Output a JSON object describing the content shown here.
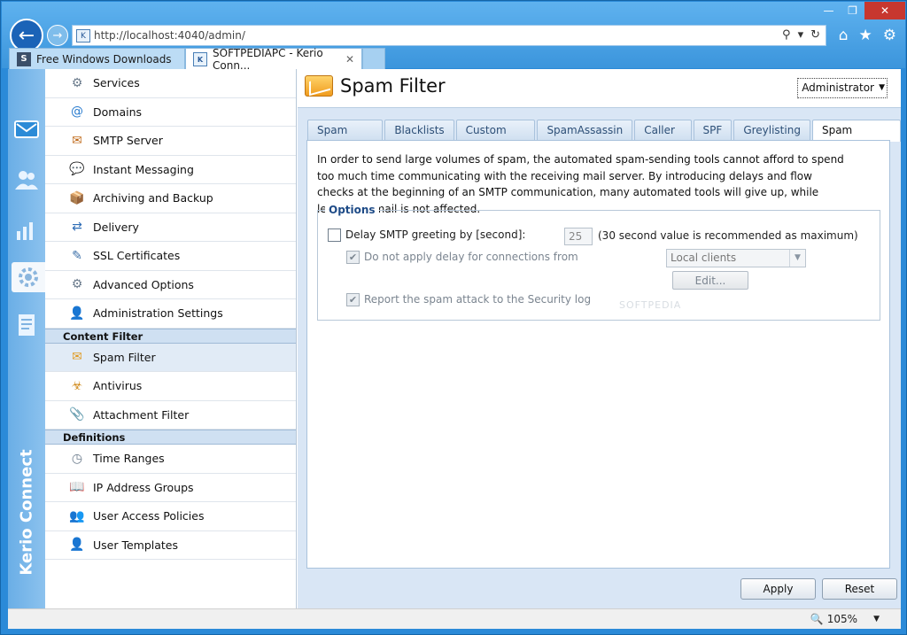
{
  "browser": {
    "window_controls": [
      "—",
      "❐",
      "✕"
    ],
    "url": "http://localhost:4040/admin/",
    "tabs": [
      {
        "label": "Free Windows Downloads",
        "favicon": "S"
      },
      {
        "label": "SOFTPEDIAPC - Kerio Conn...",
        "close": "✕"
      }
    ],
    "zoom": "105%"
  },
  "rail": {
    "brand": "Kerio Connect",
    "icons": [
      "mail-icon",
      "users-icon",
      "statistics-icon",
      "settings-icon",
      "logs-icon"
    ]
  },
  "nav": {
    "items_top": [
      {
        "label": "Services",
        "icon": "services-icon"
      },
      {
        "label": "Domains",
        "icon": "at-icon"
      },
      {
        "label": "SMTP Server",
        "icon": "smtp-icon"
      },
      {
        "label": "Instant Messaging",
        "icon": "chat-icon"
      },
      {
        "label": "Archiving and Backup",
        "icon": "archive-icon"
      },
      {
        "label": "Delivery",
        "icon": "delivery-icon"
      },
      {
        "label": "SSL Certificates",
        "icon": "certificate-icon"
      },
      {
        "label": "Advanced Options",
        "icon": "gears-icon"
      },
      {
        "label": "Administration Settings",
        "icon": "admin-icon"
      }
    ],
    "content_filter_header": "Content Filter",
    "items_content_filter": [
      {
        "label": "Spam Filter",
        "icon": "spam-icon"
      },
      {
        "label": "Antivirus",
        "icon": "antivirus-icon"
      },
      {
        "label": "Attachment Filter",
        "icon": "attachment-icon"
      }
    ],
    "definitions_header": "Definitions",
    "items_definitions": [
      {
        "label": "Time Ranges",
        "icon": "time-icon"
      },
      {
        "label": "IP Address Groups",
        "icon": "ip-book-icon"
      },
      {
        "label": "User Access Policies",
        "icon": "policy-icon"
      },
      {
        "label": "User Templates",
        "icon": "template-icon"
      }
    ]
  },
  "content": {
    "title": "Spam Filter",
    "user_menu": "Administrator",
    "tabs": [
      "Spam Rating",
      "Blacklists",
      "Custom Rules",
      "SpamAssassin",
      "Caller ID",
      "SPF",
      "Greylisting",
      "Spam Repellent"
    ],
    "active_tab": "Spam Repellent",
    "intro": "In order to send large volumes of spam, the automated spam-sending tools cannot afford to spend too much time communicating with the receiving mail server. By introducing delays and flow checks at the beginning of an SMTP communication, many automated tools will give up, while legitimate mail is not affected.",
    "options": {
      "legend": "Options",
      "delay_label": "Delay SMTP greeting by [second]:",
      "delay_value": "25",
      "delay_hint": "(30 second value is recommended as maximum)",
      "no_delay_label": "Do not apply delay for connections from",
      "no_delay_select": "Local clients",
      "edit_label": "Edit...",
      "report_label": "Report the spam attack to the Security log"
    },
    "apply_label": "Apply",
    "reset_label": "Reset"
  },
  "watermark": "SOFTPEDIA"
}
